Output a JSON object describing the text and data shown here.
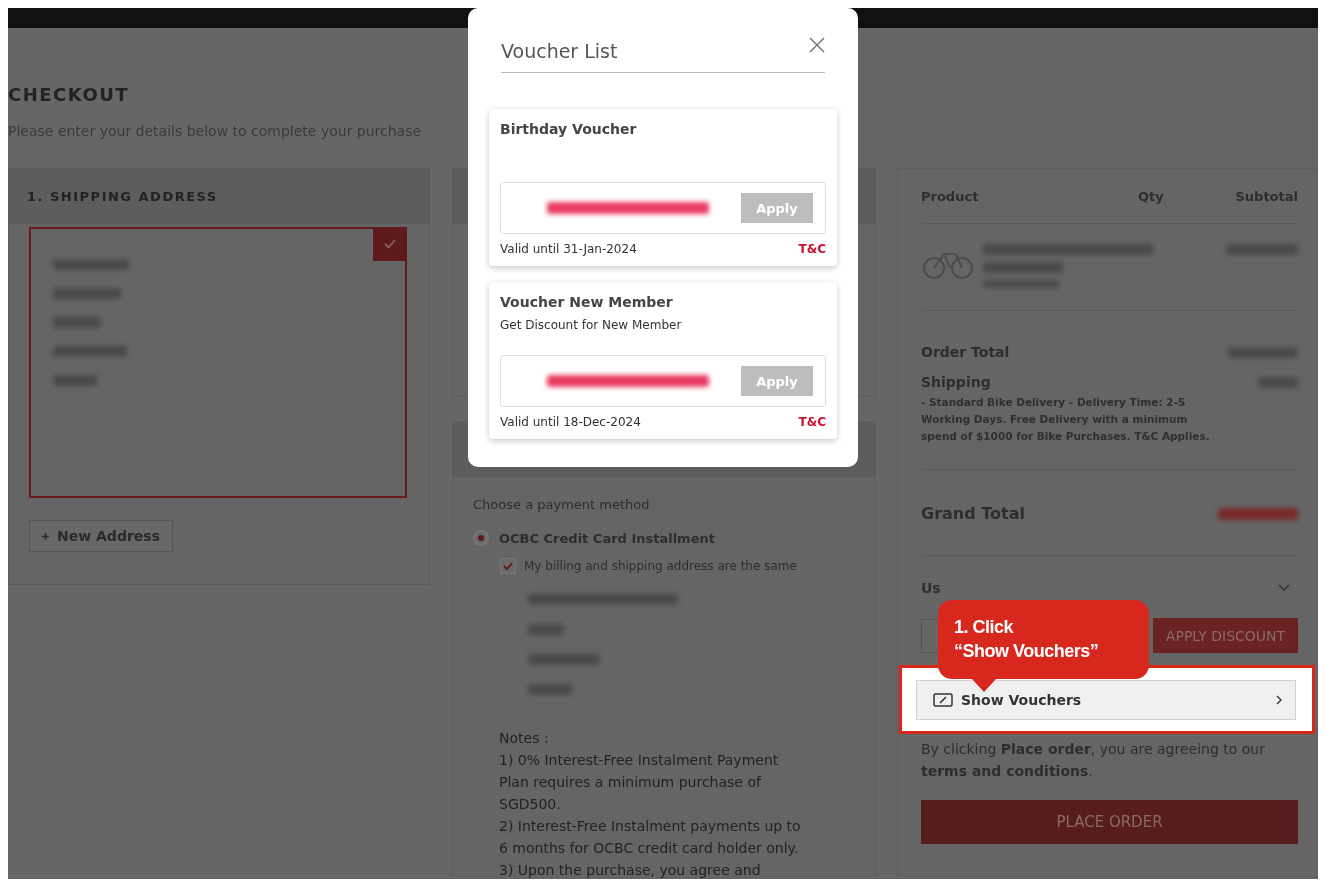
{
  "page": {
    "title": "CHECKOUT",
    "subtitle": "Please enter your details below to complete your purchase"
  },
  "shipping": {
    "title": "1. SHIPPING ADDRESS",
    "address_selected": true,
    "new_address_button": "New Address"
  },
  "payment": {
    "prompt": "Choose a payment method",
    "methods": [
      {
        "label": "OCBC Credit Card Installment",
        "selected": true
      }
    ],
    "same_address": {
      "label": "My billing and shipping address are the same",
      "checked": true
    },
    "notes_title": "Notes :",
    "notes": [
      "1) 0% Interest-Free Instalment Payment Plan requires a minimum purchase of SGD500.",
      "2) Interest-Free Instalment payments up to 6 months for OCBC credit card holder only.",
      "3) Upon the purchase, you agree and"
    ]
  },
  "summary": {
    "columns": [
      "Product",
      "Qty",
      "Subtotal"
    ],
    "order_total": "Order Total",
    "shipping": "Shipping",
    "shipping_note": "- Standard Bike Delivery - Delivery Time: 2-5 Working Days. Free Delivery with a minimum spend of $1000 for Bike Purchases. T&C Applies.",
    "grand_total": "Grand Total",
    "promo_label": "Us",
    "apply_button": "APPLY DISCOUNT",
    "show_vouchers": "Show Vouchers",
    "agreement": "By clicking **Place order**, you are agreeing to our **terms and conditions**.",
    "place_order": "PLACE ORDER"
  },
  "callout": {
    "lines": [
      "1. Click",
      "“Show Vouchers”"
    ]
  },
  "modal": {
    "title": "Voucher List",
    "vouchers": [
      {
        "name": "Birthday Voucher",
        "apply": "Apply",
        "disabled": true,
        "validity": "Valid until 31-Jan-2024",
        "terms": "T&C"
      },
      {
        "name": "Voucher New Member",
        "description": "Get Discount for New Member",
        "apply": "Apply",
        "disabled": true,
        "validity": "Valid until 18-Dec-2024",
        "terms": "T&C"
      }
    ]
  }
}
